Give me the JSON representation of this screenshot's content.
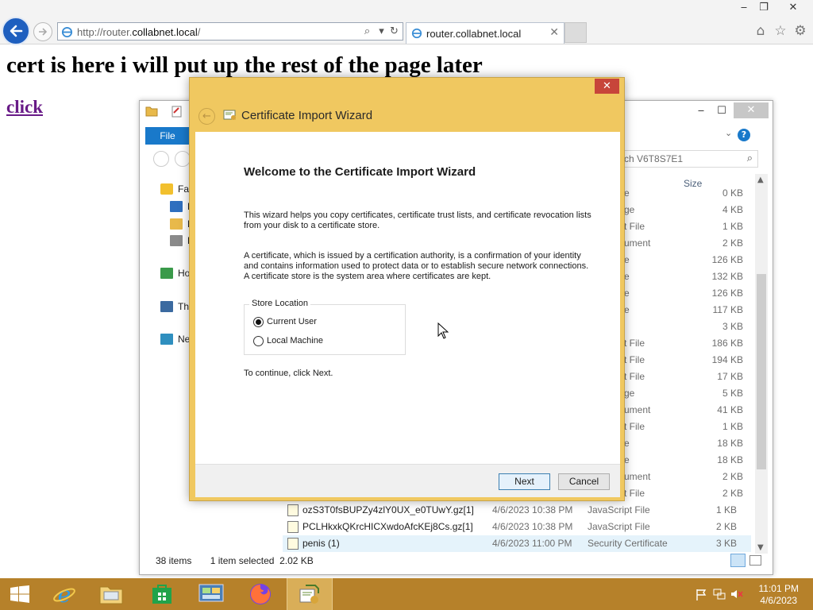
{
  "browser": {
    "url_prefix": "http://router.",
    "url_domain": "collabnet.local",
    "url_suffix": "/",
    "tab_title": "router.collabnet.local",
    "search_glyph": "⌕",
    "dropdown_glyph": "▾",
    "refresh_glyph": "↻",
    "tab_close_glyph": "✕",
    "minimize_glyph": "‒",
    "restore_glyph": "❐",
    "close_glyph": "✕",
    "home_glyph": "⌂",
    "favorites_glyph": "☆",
    "tools_glyph": "⚙"
  },
  "page": {
    "heading": "cert is here i will put up the rest of the page later",
    "link_text": "click"
  },
  "explorer": {
    "file_tab": "File",
    "search_placeholder": "ch V6T8S7E1",
    "size_column": "Size",
    "help_glyph": "?",
    "sidebar": [
      {
        "label": "Fav",
        "kind": "star"
      },
      {
        "label": "D",
        "kind": "desktop"
      },
      {
        "label": "D",
        "kind": "folder"
      },
      {
        "label": "R",
        "kind": "recent"
      },
      {
        "label": "Ho",
        "kind": "homegroup"
      },
      {
        "label": "Th",
        "kind": "computer"
      },
      {
        "label": "Ne",
        "kind": "network"
      }
    ],
    "partial_rows": [
      {
        "type": "e",
        "size": "0 KB"
      },
      {
        "type": "ge",
        "size": "4 KB"
      },
      {
        "type": "t File",
        "size": "1 KB"
      },
      {
        "type": "ument",
        "size": "2 KB"
      },
      {
        "type": "e",
        "size": "126 KB"
      },
      {
        "type": "e",
        "size": "132 KB"
      },
      {
        "type": "e",
        "size": "126 KB"
      },
      {
        "type": "e",
        "size": "117 KB"
      },
      {
        "type": "",
        "size": "3 KB"
      },
      {
        "type": "t File",
        "size": "186 KB"
      },
      {
        "type": "t File",
        "size": "194 KB"
      },
      {
        "type": "t File",
        "size": "17 KB"
      },
      {
        "type": "ge",
        "size": "5 KB"
      },
      {
        "type": "ument",
        "size": "41 KB"
      },
      {
        "type": "t File",
        "size": "1 KB"
      },
      {
        "type": "e",
        "size": "18 KB"
      },
      {
        "type": "e",
        "size": "18 KB"
      },
      {
        "type": "ument",
        "size": "2 KB"
      },
      {
        "type": "t File",
        "size": "2 KB"
      }
    ],
    "full_rows": [
      {
        "name": "ozS3T0fsBUPZy4zlY0UX_e0TUwY.gz[1]",
        "date": "4/6/2023 10:38 PM",
        "type": "JavaScript File",
        "size": "1 KB",
        "selected": false
      },
      {
        "name": "PCLHkxkQKrcHICXwdoAfcKEj8Cs.gz[1]",
        "date": "4/6/2023 10:38 PM",
        "type": "JavaScript File",
        "size": "2 KB",
        "selected": false
      },
      {
        "name": "penis (1)",
        "date": "4/6/2023 11:00 PM",
        "type": "Security Certificate",
        "size": "3 KB",
        "selected": true
      }
    ],
    "status_items": "38 items",
    "status_selected": "1 item selected  2.02 KB"
  },
  "wizard": {
    "title": "Certificate Import Wizard",
    "heading": "Welcome to the Certificate Import Wizard",
    "para1": "This wizard helps you copy certificates, certificate trust lists, and certificate revocation lists from your disk to a certificate store.",
    "para2": "A certificate, which is issued by a certification authority, is a confirmation of your identity and contains information used to protect data or to establish secure network connections. A certificate store is the system area where certificates are kept.",
    "store_legend": "Store Location",
    "opt_current_user": "Current User",
    "opt_local_machine": "Local Machine",
    "continue_text": "To continue, click Next.",
    "next_label": "Next",
    "cancel_label": "Cancel",
    "close_glyph": "✕",
    "back_glyph": "←",
    "selected_option": "current_user"
  },
  "taskbar": {
    "time": "11:01 PM",
    "date": "4/6/2023",
    "apps": [
      "start",
      "internet-explorer",
      "file-explorer",
      "store",
      "control-panel",
      "firefox",
      "certificate-manager"
    ]
  },
  "colors": {
    "wizard_frame": "#f0c860",
    "taskbar": "#b6812a",
    "link_visited": "#681a87",
    "ie_back": "#1e5fbf"
  }
}
